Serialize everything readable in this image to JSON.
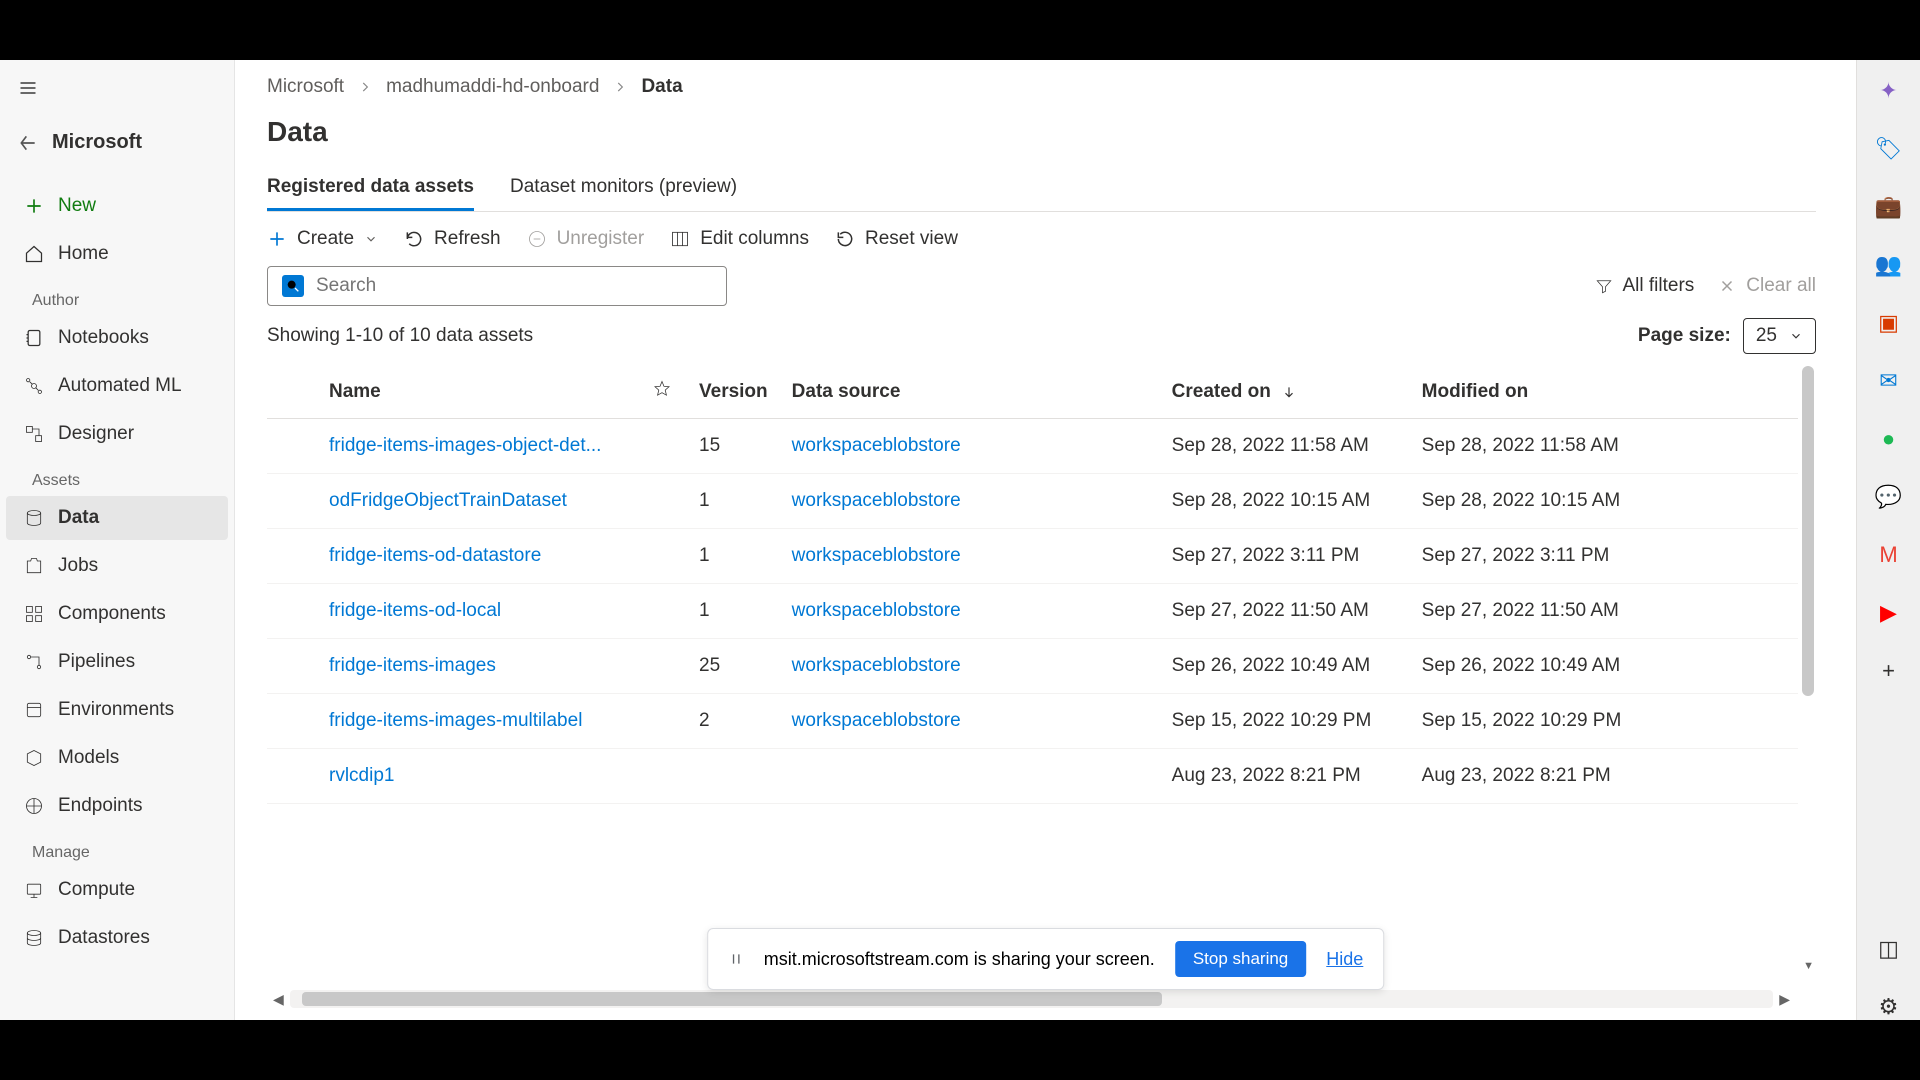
{
  "workspace_name": "Microsoft",
  "breadcrumb": {
    "root": "Microsoft",
    "mid": "madhumaddi-hd-onboard",
    "leaf": "Data"
  },
  "page_title": "Data",
  "tabs": {
    "registered": "Registered data assets",
    "monitors": "Dataset monitors (preview)"
  },
  "toolbar": {
    "create": "Create",
    "refresh": "Refresh",
    "unregister": "Unregister",
    "edit_columns": "Edit columns",
    "reset_view": "Reset view"
  },
  "search": {
    "placeholder": "Search"
  },
  "filters": {
    "all": "All filters",
    "clear": "Clear all"
  },
  "count_text": "Showing 1-10 of 10 data assets",
  "page_size": {
    "label": "Page size:",
    "value": "25"
  },
  "columns": {
    "name": "Name",
    "version": "Version",
    "data_source": "Data source",
    "created": "Created on",
    "modified": "Modified on"
  },
  "rows": [
    {
      "name": "fridge-items-images-object-det...",
      "version": "15",
      "source": "workspaceblobstore",
      "created": "Sep 28, 2022 11:58 AM",
      "modified": "Sep 28, 2022 11:58 AM"
    },
    {
      "name": "odFridgeObjectTrainDataset",
      "version": "1",
      "source": "workspaceblobstore",
      "created": "Sep 28, 2022 10:15 AM",
      "modified": "Sep 28, 2022 10:15 AM"
    },
    {
      "name": "fridge-items-od-datastore",
      "version": "1",
      "source": "workspaceblobstore",
      "created": "Sep 27, 2022 3:11 PM",
      "modified": "Sep 27, 2022 3:11 PM"
    },
    {
      "name": "fridge-items-od-local",
      "version": "1",
      "source": "workspaceblobstore",
      "created": "Sep 27, 2022 11:50 AM",
      "modified": "Sep 27, 2022 11:50 AM"
    },
    {
      "name": "fridge-items-images",
      "version": "25",
      "source": "workspaceblobstore",
      "created": "Sep 26, 2022 10:49 AM",
      "modified": "Sep 26, 2022 10:49 AM"
    },
    {
      "name": "fridge-items-images-multilabel",
      "version": "2",
      "source": "workspaceblobstore",
      "created": "Sep 15, 2022 10:29 PM",
      "modified": "Sep 15, 2022 10:29 PM"
    },
    {
      "name": "rvlcdip1",
      "version": "",
      "source": "",
      "created": "Aug 23, 2022 8:21 PM",
      "modified": "Aug 23, 2022 8:21 PM"
    }
  ],
  "sidebar": {
    "new": "New",
    "home": "Home",
    "author": "Author",
    "notebooks": "Notebooks",
    "automl": "Automated ML",
    "designer": "Designer",
    "assets": "Assets",
    "data": "Data",
    "jobs": "Jobs",
    "components": "Components",
    "pipelines": "Pipelines",
    "environments": "Environments",
    "models": "Models",
    "endpoints": "Endpoints",
    "manage": "Manage",
    "compute": "Compute",
    "datastores": "Datastores"
  },
  "share": {
    "msg": "msit.microsoftstream.com is sharing your screen.",
    "stop": "Stop sharing",
    "hide": "Hide"
  }
}
